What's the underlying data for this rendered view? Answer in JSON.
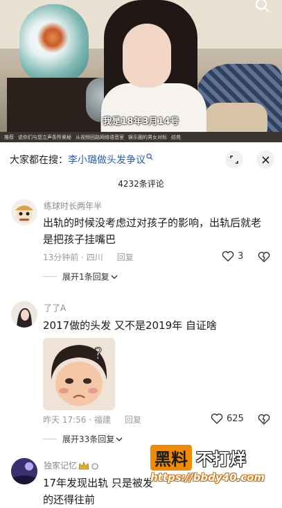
{
  "video": {
    "subtitle": "我是18年3月14号",
    "ticker": [
      "推荐",
      "说你们与您立声条所奥秘",
      "从视频回路网络语音室",
      "娱乐圈的男女对标",
      "纺苑"
    ]
  },
  "search": {
    "prefix": "大家都在搜：",
    "hot_term": "李小璐做头发争议",
    "hot_term_icon": "search-icon"
  },
  "comments_count": "4232条评论",
  "comments": [
    {
      "username": "练球时长两年半",
      "text": "出轨的时候没考虑过对孩子的影响，出轨后就老是把孩子挂嘴巴",
      "time_location": "13分钟前 · 四川",
      "reply_label": "回复",
      "likes": "3",
      "expand_label": "展开1条回复"
    },
    {
      "username": "了了A",
      "text": "2017做的头发 又不是2019年 自证啥",
      "time_location": "昨天 17:56 · 福建",
      "reply_label": "回复",
      "likes": "625",
      "expand_label": "展开33条回复"
    },
    {
      "username": "独家记忆",
      "text": "17年发现出轨 只是被发",
      "text2": "的还得往前"
    }
  ],
  "watermark": {
    "box": "黑料",
    "text": "不打烊",
    "url": "https://bbdy40.com"
  },
  "colors": {
    "link": "#2a5db0",
    "accent_orange": "#f08a00"
  }
}
